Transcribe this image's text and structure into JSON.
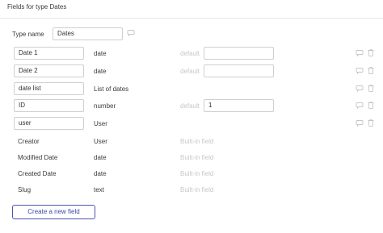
{
  "header": {
    "title": "Fields for type Dates"
  },
  "type_name": {
    "label": "Type name",
    "value": "Dates"
  },
  "fields": [
    {
      "name": "Date 1",
      "type": "date",
      "default_label": "default",
      "default_value": ""
    },
    {
      "name": "Date 2",
      "type": "date",
      "default_label": "default",
      "default_value": ""
    },
    {
      "name": "date list",
      "type": "List of dates"
    },
    {
      "name": "ID",
      "type": "number",
      "default_label": "default",
      "default_value": "1"
    },
    {
      "name": "user",
      "type": "User"
    }
  ],
  "builtin_fields": [
    {
      "name": "Creator",
      "type": "User",
      "note": "Built-in field"
    },
    {
      "name": "Modified Date",
      "type": "date",
      "note": "Built-in field"
    },
    {
      "name": "Created Date",
      "type": "date",
      "note": "Built-in field"
    },
    {
      "name": "Slug",
      "type": "text",
      "note": "Built-in field"
    }
  ],
  "actions": {
    "create_label": "Create a new field"
  },
  "icons": {
    "comment": "comment-icon",
    "trash": "trash-icon"
  }
}
